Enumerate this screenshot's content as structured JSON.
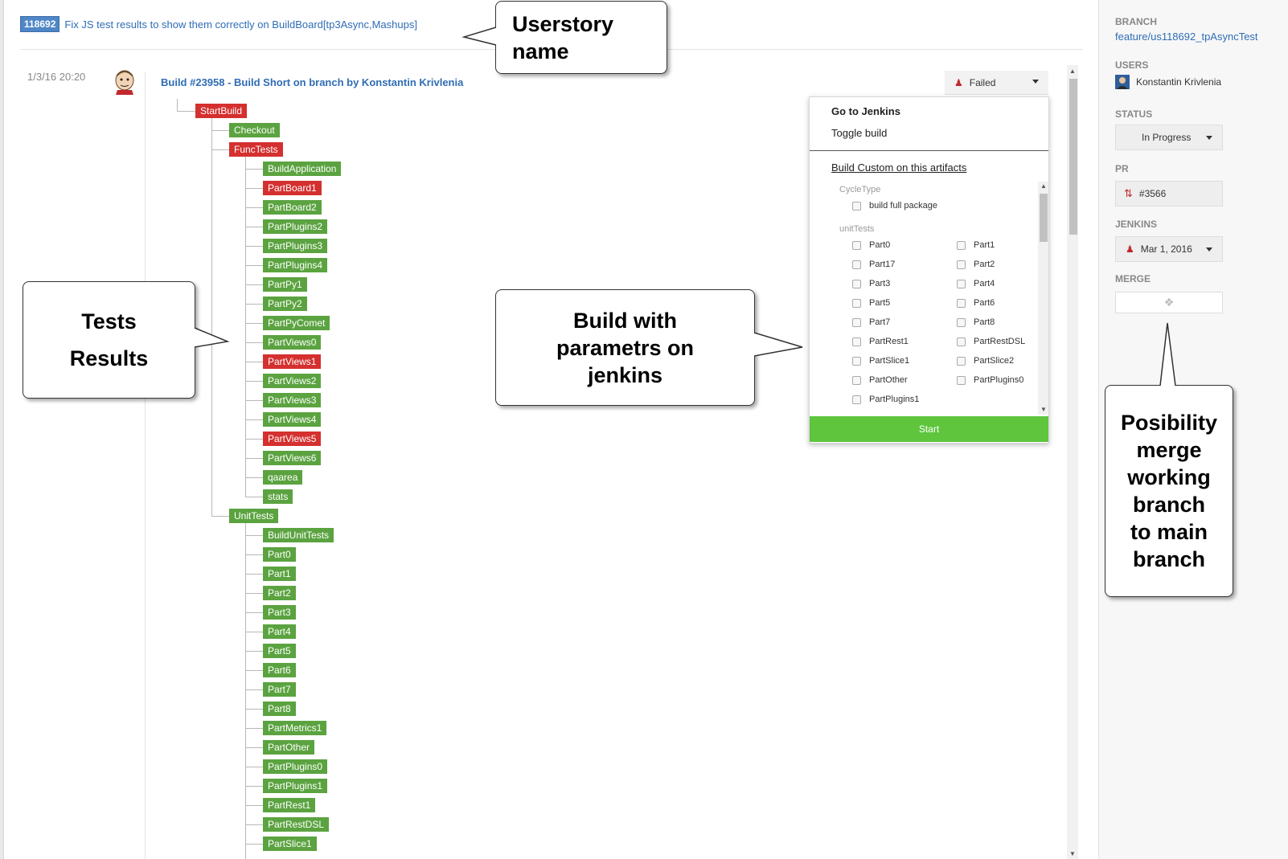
{
  "story": {
    "id": "118692",
    "title": "Fix JS test results to show them correctly on BuildBoard[tp3Async,Mashups]"
  },
  "build": {
    "date": "1/3/16 20:20",
    "title": "Build #23958 - Build Short on branch by Konstantin Krivlenia",
    "status_label": "Failed"
  },
  "tree": {
    "root": "StartBuild",
    "level1": [
      "Checkout",
      "FuncTests",
      "UnitTests"
    ],
    "func_tests": [
      "BuildApplication",
      "PartBoard1",
      "PartBoard2",
      "PartPlugins2",
      "PartPlugins3",
      "PartPlugins4",
      "PartPy1",
      "PartPy2",
      "PartPyComet",
      "PartViews0",
      "PartViews1",
      "PartViews2",
      "PartViews3",
      "PartViews4",
      "PartViews5",
      "PartViews6",
      "qaarea",
      "stats"
    ],
    "func_tests_failed": [
      "PartBoard1",
      "PartViews1",
      "PartViews5"
    ],
    "unit_tests": [
      "BuildUnitTests",
      "Part0",
      "Part1",
      "Part2",
      "Part3",
      "Part4",
      "Part5",
      "Part6",
      "Part7",
      "Part8",
      "PartMetrics1",
      "PartOther",
      "PartPlugins0",
      "PartPlugins1",
      "PartRest1",
      "PartRestDSL",
      "PartSlice1"
    ]
  },
  "dropdown": {
    "go_to_jenkins": "Go to Jenkins",
    "toggle_build": "Toggle build",
    "build_custom": "Build Custom on this artifacts",
    "cycle_type_label": "CycleType",
    "cycle_type_option": "build full package",
    "unit_tests_label": "unitTests",
    "unit_tests_col1": [
      "Part0",
      "Part17",
      "Part3",
      "Part5",
      "Part7",
      "PartRest1",
      "PartSlice1",
      "PartOther",
      "PartPlugins1"
    ],
    "unit_tests_col2": [
      "Part1",
      "Part2",
      "Part4",
      "Part6",
      "Part8",
      "PartRestDSL",
      "PartSlice2",
      "PartPlugins0"
    ],
    "start_label": "Start"
  },
  "sidebar": {
    "branch_label": "BRANCH",
    "branch_value": "feature/us118692_tpAsyncTest",
    "users_label": "USERS",
    "user_name": "Konstantin Krivlenia",
    "status_label": "STATUS",
    "status_value": "In Progress",
    "pr_label": "PR",
    "pr_value": "#3566",
    "jenkins_label": "JENKINS",
    "jenkins_value": "Mar 1, 2016",
    "merge_label": "MERGE"
  },
  "callouts": {
    "userstory": [
      "Userstory",
      "name"
    ],
    "tests": [
      "Tests",
      "Results"
    ],
    "build_params": [
      "Build with",
      "parametrs on",
      "jenkins"
    ],
    "merge": [
      "Posibility",
      "merge",
      "working",
      "branch",
      "to main",
      "branch"
    ]
  },
  "colors": {
    "pass": "#5ba340",
    "fail": "#d4302f",
    "link": "#2f6db5",
    "start": "#5ec53d"
  }
}
